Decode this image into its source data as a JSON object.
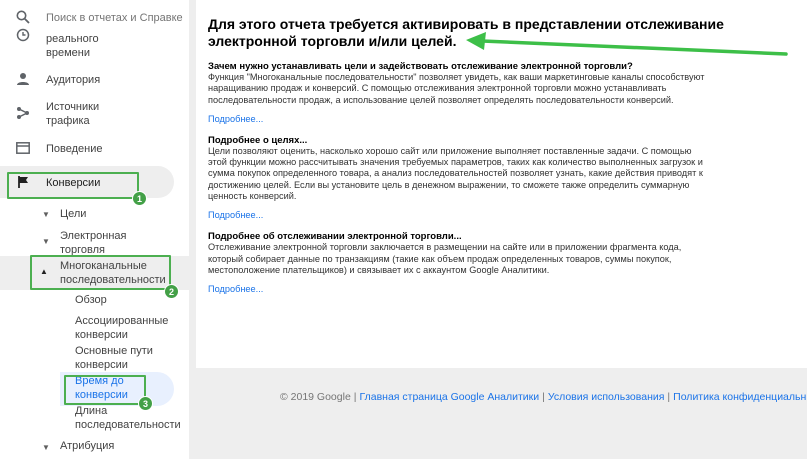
{
  "search": {
    "placeholder": "Поиск в отчетах и Справке"
  },
  "sidebar": {
    "realtime_partial": "реального\nвремени",
    "audience": "Аудитория",
    "sources": "Источники\nтрафика",
    "behavior": "Поведение",
    "conversions": "Конверсии",
    "goals": "Цели",
    "ecommerce": "Электронная\nторговля",
    "mcf": "Многоканальные\nпоследовательности",
    "overview": "Обзор",
    "assisted": "Ассоциированные\nконверсии",
    "top_paths": "Основные пути\nконверсии",
    "time_lag": "Время до\nконверсии",
    "path_length": "Длина\nпоследовательности",
    "attribution": "Атрибуция"
  },
  "badges": [
    "1",
    "2",
    "3"
  ],
  "colors": {
    "highlight": "#4caf50",
    "accent": "#1a73e8",
    "arrow": "#3dbf48"
  },
  "main": {
    "title": "Для этого отчета требуется активировать в представлении отслеживание электронной торговли и/или целей.",
    "sections": [
      {
        "heading": "Зачем нужно устанавливать цели и задействовать отслеживание электронной торговли?",
        "text": "Функция \"Многоканальные последовательности\" позволяет увидеть, как ваши маркетинговые каналы способствуют наращиванию продаж и конверсий. С помощью отслеживания электронной торговли можно устанавливать последовательности продаж, а использование целей позволяет определять последовательности конверсий.",
        "link": "Подробнее..."
      },
      {
        "heading": "Подробнее о целях...",
        "text": "Цели позволяют оценить, насколько хорошо сайт или приложение выполняет поставленные задачи. С помощью этой функции можно рассчитывать значения требуемых параметров, таких как количество выполненных загрузок и сумма покупок определенного товара, а анализ последовательностей позволяет узнать, какие действия приводят к достижению целей. Если вы установите цель в денежном выражении, то сможете также определить суммарную ценность конверсий.",
        "link": "Подробнее..."
      },
      {
        "heading": "Подробнее об отслеживании электронной торговли...",
        "text": "Отслеживание электронной торговли заключается в размещении на сайте или в приложении фрагмента кода, который собирает данные по транзакциям (такие как объем продаж определенных товаров, суммы покупок, местоположение плательщиков) и связывает их с аккаунтом Google Аналитики.",
        "link": "Подробнее..."
      }
    ]
  },
  "footer": {
    "copyright": "© 2019 Google",
    "links": [
      "Главная страница Google Аналитики",
      "Условия использования",
      "Политика конфиденциальн"
    ]
  }
}
